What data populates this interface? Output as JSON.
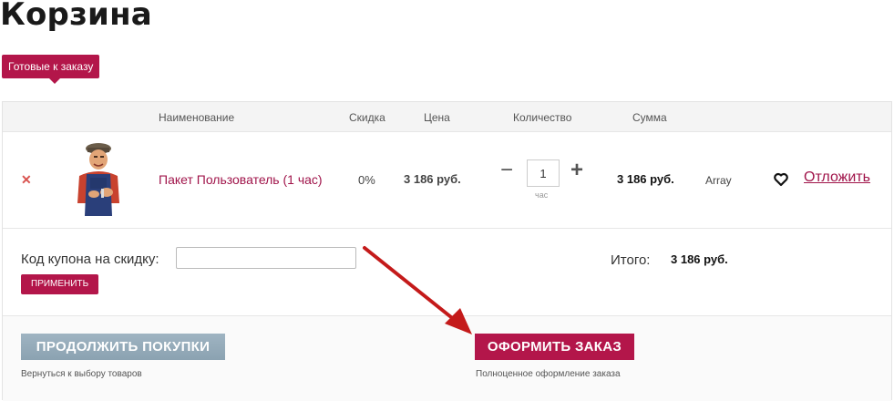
{
  "page": {
    "title": "Корзина"
  },
  "tabs": {
    "ready_label": "Готовые к заказу"
  },
  "table": {
    "headers": {
      "name": "Наименование",
      "discount": "Скидка",
      "price": "Цена",
      "quantity": "Количество",
      "sum": "Сумма"
    }
  },
  "item": {
    "remove_glyph": "✕",
    "name": "Пакет Пользователь (1 час)",
    "discount": "0%",
    "price": "3 186 руб.",
    "qty_minus": "−",
    "qty_value": "1",
    "qty_plus": "+",
    "qty_unit": "час",
    "sum": "3 186 руб.",
    "extra": "Array",
    "defer_label": "Отложить"
  },
  "coupon": {
    "label": "Код купона на скидку:",
    "value": "",
    "apply_label": "ПРИМЕНИТЬ"
  },
  "total": {
    "label": "Итого:",
    "value": "3 186 руб."
  },
  "actions": {
    "continue_label": "ПРОДОЛЖИТЬ ПОКУПКИ",
    "continue_note": "Вернуться к выбору товаров",
    "order_label": "ОФОРМИТЬ ЗАКАЗ",
    "order_note": "Полноценное оформление заказа"
  },
  "colors": {
    "accent": "#b3164a",
    "continue_button": "#8ba2b1",
    "annotation_arrow": "#c41a1a"
  },
  "icons": {
    "remove": "close-icon",
    "favorite": "heart-icon",
    "product": "worker-illustration"
  }
}
